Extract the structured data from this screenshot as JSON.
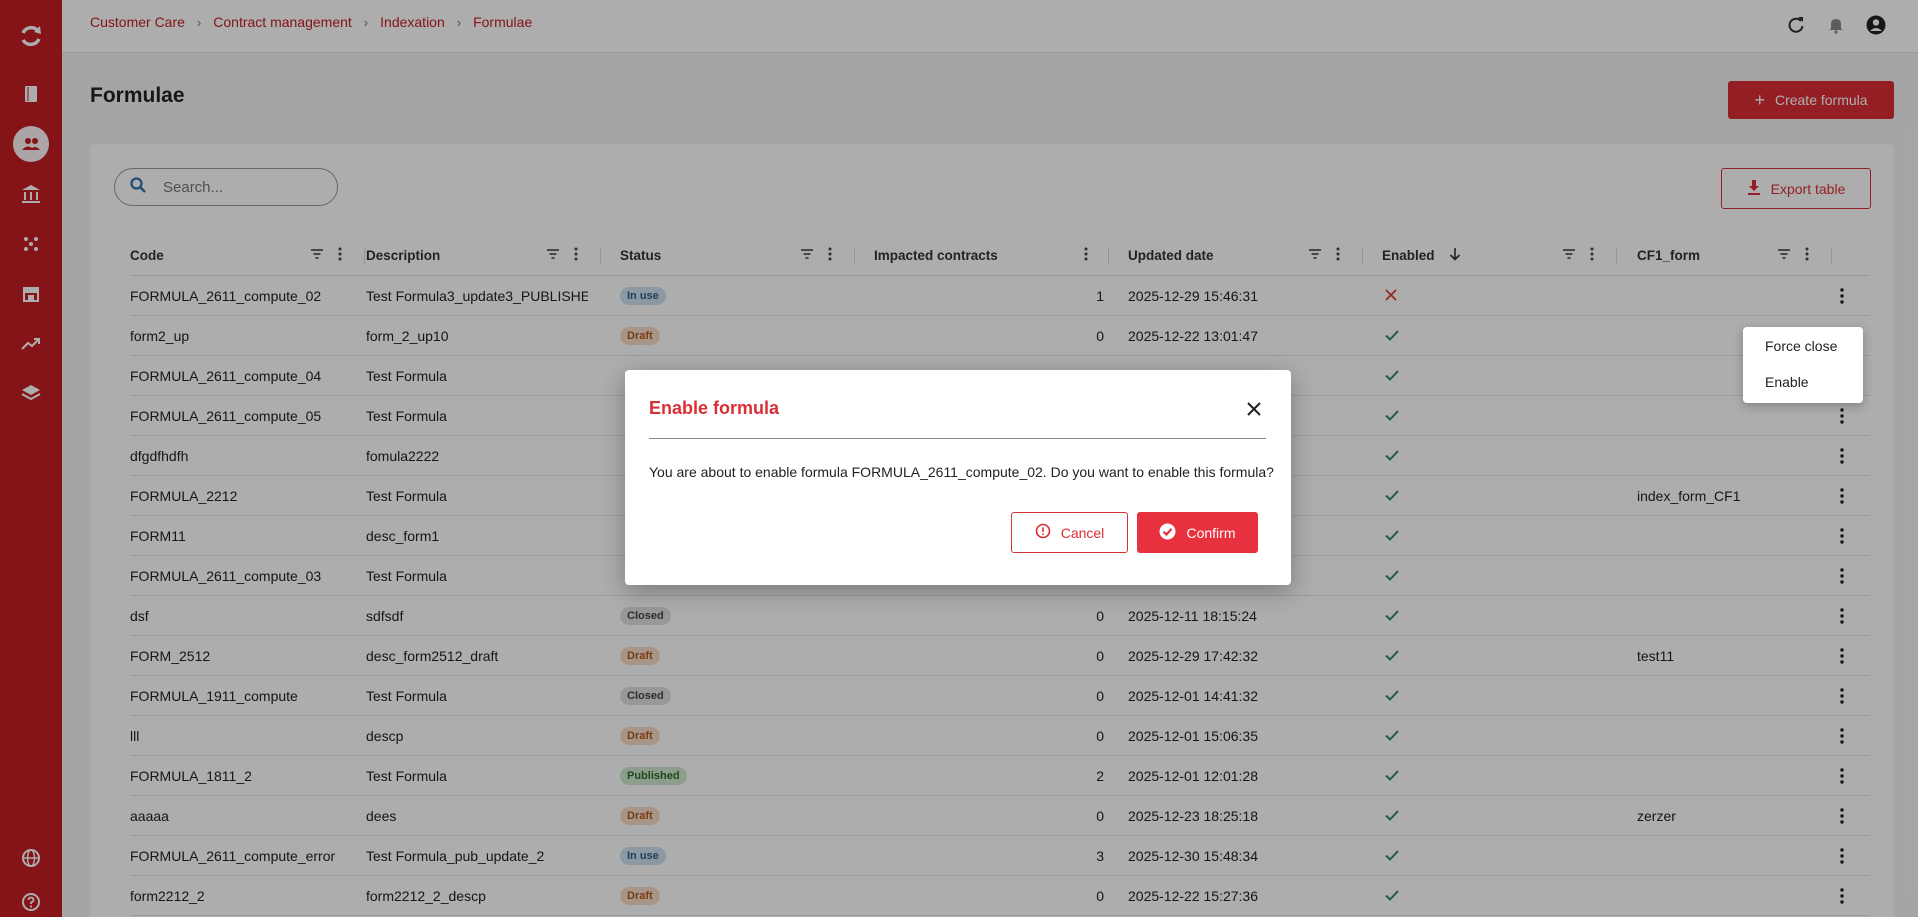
{
  "breadcrumb": [
    "Customer Care",
    "Contract management",
    "Indexation",
    "Formulae"
  ],
  "page": {
    "title": "Formulae",
    "create_label": "Create formula",
    "export_label": "Export table",
    "search_placeholder": "Search..."
  },
  "table": {
    "columns": [
      "Code",
      "Description",
      "Status",
      "Impacted contracts",
      "Updated date",
      "Enabled",
      "CF1_form"
    ],
    "rows": [
      {
        "code": "FORMULA_2611_compute_02",
        "description": "Test Formula3_update3_PUBLISHED",
        "status": "In use",
        "impacted": "1",
        "updated": "2025-12-29 15:46:31",
        "enabled": false,
        "cf1": ""
      },
      {
        "code": "form2_up",
        "description": "form_2_up10",
        "status": "Draft",
        "impacted": "0",
        "updated": "2025-12-22 13:01:47",
        "enabled": true,
        "cf1": ""
      },
      {
        "code": "FORMULA_2611_compute_04",
        "description": "Test Formula",
        "status": "",
        "impacted": "",
        "updated": "",
        "enabled": true,
        "cf1": ""
      },
      {
        "code": "FORMULA_2611_compute_05",
        "description": "Test Formula",
        "status": "",
        "impacted": "",
        "updated": "",
        "enabled": true,
        "cf1": ""
      },
      {
        "code": "dfgdfhdfh",
        "description": "fomula2222",
        "status": "",
        "impacted": "",
        "updated": "",
        "enabled": true,
        "cf1": ""
      },
      {
        "code": "FORMULA_2212",
        "description": "Test Formula",
        "status": "",
        "impacted": "",
        "updated": "",
        "enabled": true,
        "cf1": "index_form_CF1"
      },
      {
        "code": "FORM11",
        "description": "desc_form1",
        "status": "",
        "impacted": "",
        "updated": "",
        "enabled": true,
        "cf1": ""
      },
      {
        "code": "FORMULA_2611_compute_03",
        "description": "Test Formula",
        "status": "",
        "impacted": "",
        "updated": "",
        "enabled": true,
        "cf1": ""
      },
      {
        "code": "dsf",
        "description": "sdfsdf",
        "status": "Closed",
        "impacted": "0",
        "updated": "2025-12-11 18:15:24",
        "enabled": true,
        "cf1": ""
      },
      {
        "code": "FORM_2512",
        "description": "desc_form2512_draft",
        "status": "Draft",
        "impacted": "0",
        "updated": "2025-12-29 17:42:32",
        "enabled": true,
        "cf1": "test11"
      },
      {
        "code": "FORMULA_1911_compute",
        "description": "Test Formula",
        "status": "Closed",
        "impacted": "0",
        "updated": "2025-12-01 14:41:32",
        "enabled": true,
        "cf1": ""
      },
      {
        "code": "lll",
        "description": "descp",
        "status": "Draft",
        "impacted": "0",
        "updated": "2025-12-01 15:06:35",
        "enabled": true,
        "cf1": ""
      },
      {
        "code": "FORMULA_1811_2",
        "description": "Test Formula",
        "status": "Published",
        "impacted": "2",
        "updated": "2025-12-01 12:01:28",
        "enabled": true,
        "cf1": ""
      },
      {
        "code": "aaaaa",
        "description": "dees",
        "status": "Draft",
        "impacted": "0",
        "updated": "2025-12-23 18:25:18",
        "enabled": true,
        "cf1": "zerzer"
      },
      {
        "code": "FORMULA_2611_compute_error",
        "description": "Test Formula_pub_update_2",
        "status": "In use",
        "impacted": "3",
        "updated": "2025-12-30 15:48:34",
        "enabled": true,
        "cf1": ""
      },
      {
        "code": "form2212_2",
        "description": "form2212_2_descp",
        "status": "Draft",
        "impacted": "0",
        "updated": "2025-12-22 15:27:36",
        "enabled": true,
        "cf1": ""
      }
    ]
  },
  "context_menu": [
    "Force close",
    "Enable"
  ],
  "modal": {
    "title": "Enable formula",
    "message": "You are about to enable formula FORMULA_2611_compute_02. Do you want to enable this formula?",
    "cancel_label": "Cancel",
    "confirm_label": "Confirm"
  },
  "colors": {
    "brand_red": "#c41e24",
    "button_red": "#d92f36",
    "check_green": "#2e8b57",
    "cross_red": "#e03a3a"
  }
}
